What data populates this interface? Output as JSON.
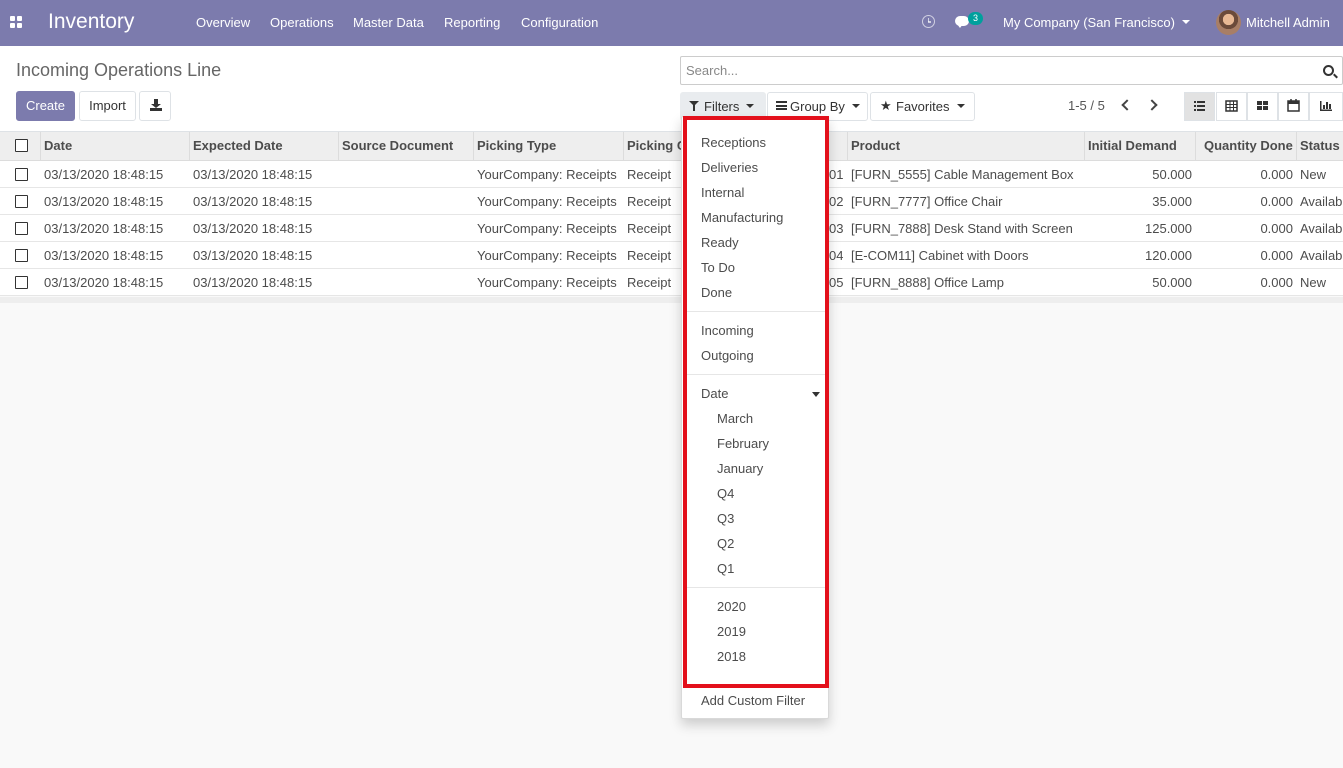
{
  "navbar": {
    "app_title": "Inventory",
    "menu": [
      "Overview",
      "Operations",
      "Master Data",
      "Reporting",
      "Configuration"
    ],
    "chat_count": "3",
    "company": "My Company (San Francisco)",
    "user": "Mitchell Admin",
    "icons": [
      "apps-icon",
      "clock-icon",
      "chat-icon",
      "avatar"
    ]
  },
  "control_panel": {
    "title": "Incoming Operations Line",
    "create_label": "Create",
    "import_label": "Import",
    "search_placeholder": "Search...",
    "filters_label": "Filters",
    "groupby_label": "Group By",
    "favorites_label": "Favorites",
    "pager": "1-5 / 5",
    "views": [
      "list-view-icon",
      "pivot-view-icon",
      "kanban-view-icon",
      "calendar-view-icon",
      "graph-view-icon"
    ]
  },
  "table": {
    "columns": [
      "Date",
      "Expected Date",
      "Source Document",
      "Picking Type",
      "Picking C",
      "Product",
      "Initial Demand",
      "Quantity Done",
      "Status"
    ],
    "rows": [
      {
        "date": "03/13/2020 18:48:15",
        "expected": "03/13/2020 18:48:15",
        "source": "",
        "picking_type": "YourCompany: Receipts",
        "picking_code": "Receipt",
        "ref_tail": "01",
        "product": "[FURN_5555] Cable Management Box",
        "demand": "50.000",
        "done": "0.000",
        "status": "New"
      },
      {
        "date": "03/13/2020 18:48:15",
        "expected": "03/13/2020 18:48:15",
        "source": "",
        "picking_type": "YourCompany: Receipts",
        "picking_code": "Receipt",
        "ref_tail": "02",
        "product": "[FURN_7777] Office Chair",
        "demand": "35.000",
        "done": "0.000",
        "status": "Available"
      },
      {
        "date": "03/13/2020 18:48:15",
        "expected": "03/13/2020 18:48:15",
        "source": "",
        "picking_type": "YourCompany: Receipts",
        "picking_code": "Receipt",
        "ref_tail": "03",
        "product": "[FURN_7888] Desk Stand with Screen",
        "demand": "125.000",
        "done": "0.000",
        "status": "Available"
      },
      {
        "date": "03/13/2020 18:48:15",
        "expected": "03/13/2020 18:48:15",
        "source": "",
        "picking_type": "YourCompany: Receipts",
        "picking_code": "Receipt",
        "ref_tail": "04",
        "product": "[E-COM11] Cabinet with Doors",
        "demand": "120.000",
        "done": "0.000",
        "status": "Available"
      },
      {
        "date": "03/13/2020 18:48:15",
        "expected": "03/13/2020 18:48:15",
        "source": "",
        "picking_type": "YourCompany: Receipts",
        "picking_code": "Receipt",
        "ref_tail": "05",
        "product": "[FURN_8888] Office Lamp",
        "demand": "50.000",
        "done": "0.000",
        "status": "New"
      }
    ]
  },
  "filters_dropdown": {
    "group1": [
      "Receptions",
      "Deliveries",
      "Internal",
      "Manufacturing",
      "Ready",
      "To Do",
      "Done"
    ],
    "group2": [
      "Incoming",
      "Outgoing"
    ],
    "date_label": "Date",
    "date_options": [
      "March",
      "February",
      "January",
      "Q4",
      "Q3",
      "Q2",
      "Q1"
    ],
    "year_options": [
      "2020",
      "2019",
      "2018"
    ],
    "custom_filter": "Add Custom Filter"
  },
  "colors": {
    "navbar": "#7c7bad",
    "badge": "#00a09d",
    "highlight": "#e3101b"
  }
}
